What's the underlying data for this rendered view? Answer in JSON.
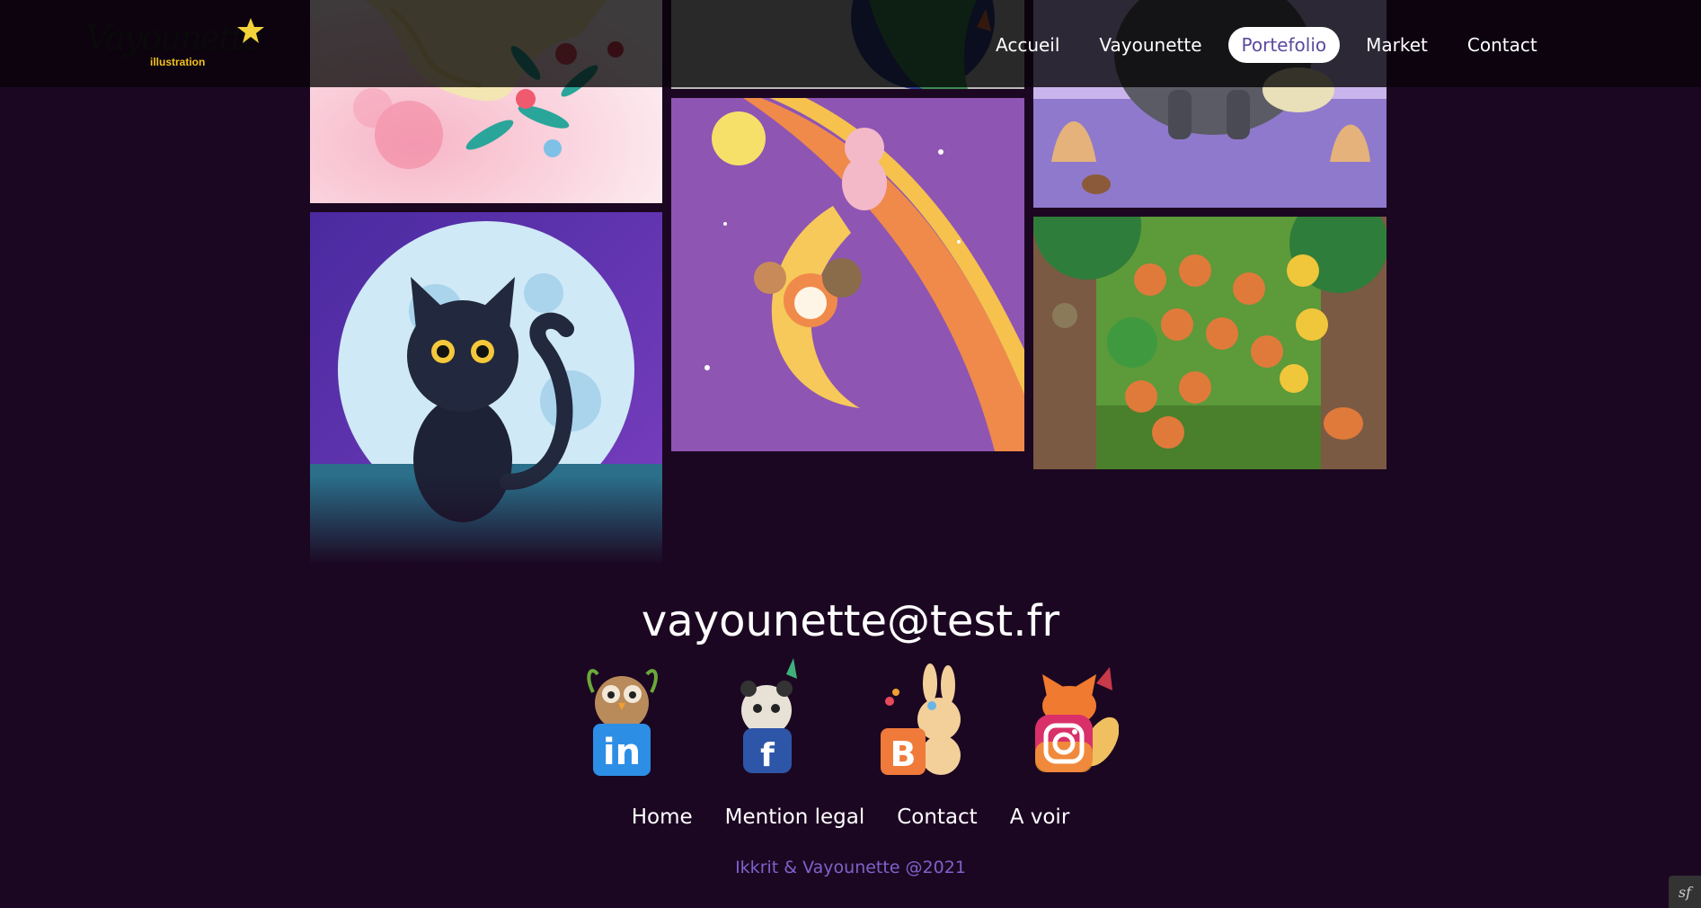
{
  "header": {
    "logo_script": "Vayounette",
    "logo_sub": "illustration",
    "nav": [
      {
        "label": "Accueil",
        "active": false
      },
      {
        "label": "Vayounette",
        "active": false
      },
      {
        "label": "Portefolio",
        "active": true
      },
      {
        "label": "Market",
        "active": false
      },
      {
        "label": "Contact",
        "active": false
      }
    ]
  },
  "gallery": {
    "items": [
      {
        "subject": "girl with flowers"
      },
      {
        "subject": "woman portrait"
      },
      {
        "subject": "wolf and bird"
      },
      {
        "subject": "black cat and moon"
      },
      {
        "subject": "animals on moon"
      },
      {
        "subject": "forest with fox"
      }
    ]
  },
  "footer": {
    "email": "vayounette@test.fr",
    "socials": [
      {
        "name": "linkedin",
        "glyph": "in"
      },
      {
        "name": "facebook",
        "glyph": "f"
      },
      {
        "name": "blog",
        "glyph": "B"
      },
      {
        "name": "instagram",
        "glyph": ""
      }
    ],
    "links": [
      "Home",
      "Mention legal",
      "Contact",
      "A voir"
    ],
    "copyright": "Ikkrit & Vayounette @2021"
  },
  "colors": {
    "background": "#1c0722",
    "accent": "#7d63c9",
    "active_nav_text": "#5b4a9e",
    "logo_yellow": "#f4c21a"
  }
}
